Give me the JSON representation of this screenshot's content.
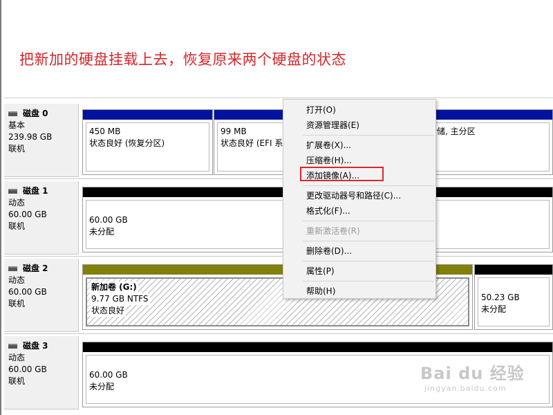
{
  "caption": "把新加的硬盘挂载上去，恢复原来两个硬盘的状态",
  "disks": [
    {
      "name": "磁盘 0",
      "type": "基本",
      "size": "239.98 GB",
      "status": "联机",
      "partitions": [
        {
          "size": "450 MB",
          "desc": "状态良好 (恢复分区)"
        },
        {
          "size": "99 MB",
          "desc": "状态良好 (EFI 系"
        },
        {
          "size": "",
          "desc": "转储, 主分区"
        }
      ]
    },
    {
      "name": "磁盘 1",
      "type": "动态",
      "size": "60.00 GB",
      "status": "联机",
      "partitions": [
        {
          "size": "60.00 GB",
          "desc": "未分配"
        }
      ]
    },
    {
      "name": "磁盘 2",
      "type": "动态",
      "size": "60.00 GB",
      "status": "联机",
      "partitions": [
        {
          "label": "新加卷 (G:)",
          "size": "9.77 GB NTFS",
          "desc": "状态良好"
        },
        {
          "size": "50.23 GB",
          "desc": "未分配"
        }
      ]
    },
    {
      "name": "磁盘 3",
      "type": "动态",
      "size": "60.00 GB",
      "status": "联机",
      "partitions": [
        {
          "size": "60.00 GB",
          "desc": "未分配"
        }
      ]
    }
  ],
  "context_menu": {
    "open": "打开(O)",
    "explorer": "资源管理器(E)",
    "extend": "扩展卷(X)...",
    "shrink": "压缩卷(H)...",
    "add_mirror": "添加镜像(A)...",
    "change_letter": "更改驱动器号和路径(C)...",
    "format": "格式化(F)...",
    "reactivate": "重新激活卷(R)",
    "delete": "删除卷(D)...",
    "properties": "属性(P)",
    "help": "帮助(H)"
  },
  "watermark": {
    "logo": "Bai du 经验",
    "url": "jingyan.baidu.com"
  },
  "colors": {
    "caption": "#d6262a",
    "primary_bar": "#00139e",
    "simple_bar": "#80800a",
    "unallocated_bar": "#000000",
    "highlight": "#e0252a"
  }
}
